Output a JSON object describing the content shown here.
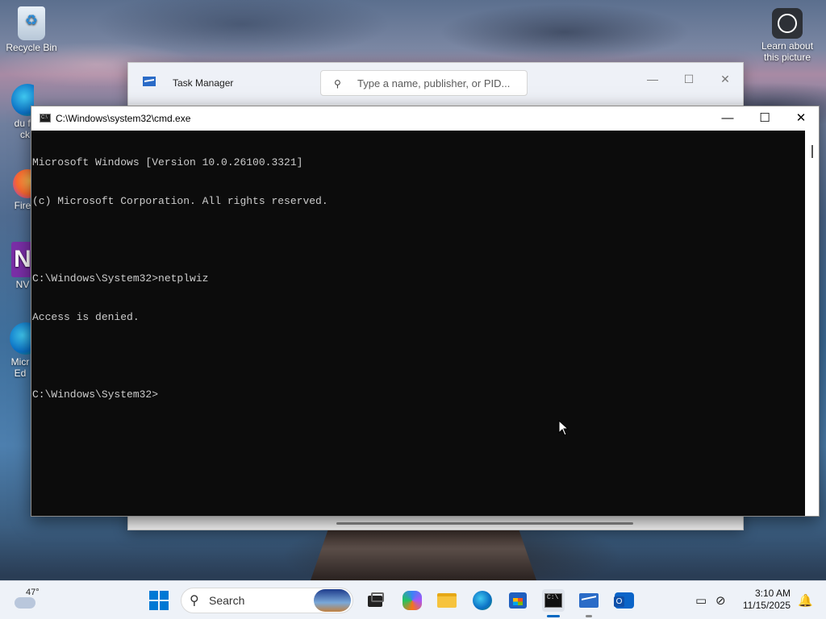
{
  "desktop": {
    "icons": [
      {
        "label": "Recycle Bin"
      },
      {
        "label": "du fuck"
      },
      {
        "label": "Fire"
      },
      {
        "label": "NV"
      },
      {
        "label": "Micr Ed"
      }
    ],
    "spotlight_label": "Learn about this picture"
  },
  "task_manager": {
    "title": "Task Manager",
    "search_placeholder": "Type a name, publisher, or PID..."
  },
  "cmd": {
    "title": "C:\\Windows\\system32\\cmd.exe",
    "lines": [
      "Microsoft Windows [Version 10.0.26100.3321]",
      "(c) Microsoft Corporation. All rights reserved.",
      "",
      "C:\\Windows\\System32>netplwiz",
      "Access is denied.",
      "",
      "C:\\Windows\\System32>"
    ]
  },
  "taskbar": {
    "weather_temp": "47°",
    "search_label": "Search",
    "time": "3:10 AM",
    "date": "11/15/2025"
  },
  "colors": {
    "cmd_bg": "#0c0c0c",
    "cmd_text": "#cccccc",
    "taskbar_bg": "#eef2f8",
    "accent": "#0067c0"
  }
}
